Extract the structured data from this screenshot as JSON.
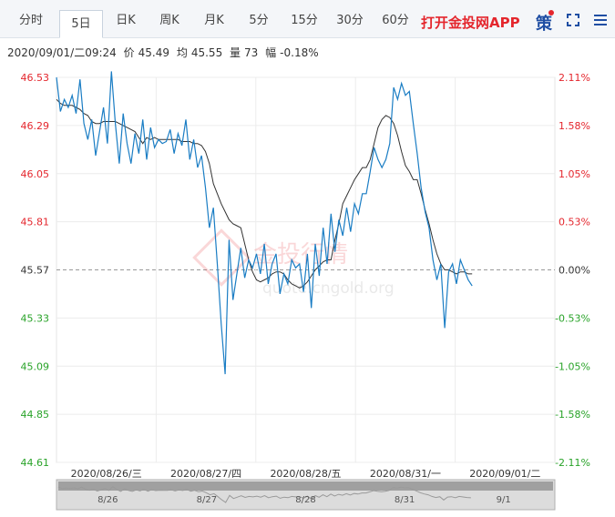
{
  "tabs": [
    {
      "label": "分时",
      "active": false
    },
    {
      "label": "5日",
      "active": true
    },
    {
      "label": "日K",
      "active": false
    },
    {
      "label": "周K",
      "active": false
    },
    {
      "label": "月K",
      "active": false
    },
    {
      "label": "5分",
      "active": false
    },
    {
      "label": "15分",
      "active": false
    },
    {
      "label": "30分",
      "active": false
    },
    {
      "label": "60分",
      "active": false
    }
  ],
  "promo_label": "打开金投网APP",
  "toolbar": {
    "ce_label": "策",
    "fullscreen_icon": "fullscreen-icon",
    "menu_icon": "menu-icon"
  },
  "info": {
    "datetime": "2020/09/01/二09:24",
    "price_label": "价",
    "price": "45.49",
    "avg_label": "均",
    "avg": "45.55",
    "volume_label": "量",
    "volume": "73",
    "change_label": "幅",
    "change": "-0.18%"
  },
  "watermark": {
    "text": "金投行情",
    "url": "quote.cngold.org"
  },
  "colors": {
    "up": "#e4262d",
    "down": "#29a329",
    "price_line": "#1a7dc4",
    "avg_line": "#333333",
    "axis_text": "#333333"
  },
  "chart_data": {
    "type": "line",
    "y_axis_left": [
      "46.53",
      "46.29",
      "46.05",
      "45.81",
      "45.57",
      "45.33",
      "45.09",
      "44.85",
      "44.61"
    ],
    "y_axis_right": [
      "2.11%",
      "1.58%",
      "1.05%",
      "0.53%",
      "0.00%",
      "-0.53%",
      "-1.05%",
      "-1.58%",
      "-2.11%"
    ],
    "ylim": [
      44.61,
      46.53
    ],
    "reference_price": 45.57,
    "days": [
      "2020/08/26/三",
      "2020/08/27/四",
      "2020/08/28/五",
      "2020/08/31/一",
      "2020/09/01/二"
    ],
    "navigator_labels": [
      "8/26",
      "8/27",
      "8/28",
      "8/31",
      "9/1"
    ],
    "series": [
      {
        "name": "价",
        "values": [
          46.53,
          46.36,
          46.42,
          46.38,
          46.44,
          46.35,
          46.52,
          46.3,
          46.22,
          46.32,
          46.14,
          46.26,
          46.38,
          46.2,
          46.56,
          46.3,
          46.1,
          46.35,
          46.2,
          46.1,
          46.25,
          46.15,
          46.32,
          46.12,
          46.28,
          46.18,
          46.22,
          46.2,
          46.21,
          46.27,
          46.15,
          46.25,
          46.19,
          46.32,
          46.12,
          46.22,
          46.08,
          46.14,
          45.98,
          45.78,
          45.88,
          45.6,
          45.3,
          45.05,
          45.72,
          45.42,
          45.55,
          45.68,
          45.53,
          45.62,
          45.58,
          45.65,
          45.55,
          45.7,
          45.5,
          45.6,
          45.65,
          45.45,
          45.55,
          45.5,
          45.62,
          45.58,
          45.6,
          45.46,
          45.65,
          45.38,
          45.7,
          45.54,
          45.78,
          45.6,
          45.85,
          45.66,
          45.82,
          45.74,
          45.88,
          45.76,
          45.9,
          45.85,
          45.95,
          45.95,
          46.06,
          46.18,
          46.12,
          46.08,
          46.12,
          46.2,
          46.48,
          46.42,
          46.5,
          46.44,
          46.46,
          46.3,
          46.15,
          45.98,
          45.86,
          45.78,
          45.62,
          45.52,
          45.6,
          45.28,
          45.56,
          45.6,
          45.5,
          45.62,
          45.57,
          45.52,
          45.49
        ]
      },
      {
        "name": "均",
        "values": [
          46.42,
          46.4,
          46.39,
          46.39,
          46.39,
          46.38,
          46.37,
          46.35,
          46.34,
          46.31,
          46.3,
          46.3,
          46.31,
          46.31,
          46.31,
          46.31,
          46.3,
          46.29,
          46.28,
          46.27,
          46.26,
          46.23,
          46.2,
          46.23,
          46.22,
          46.23,
          46.22,
          46.22,
          46.22,
          46.22,
          46.22,
          46.22,
          46.21,
          46.21,
          46.21,
          46.2,
          46.2,
          46.19,
          46.16,
          46.1,
          46.0,
          45.95,
          45.9,
          45.86,
          45.82,
          45.8,
          45.79,
          45.78,
          45.7,
          45.62,
          45.56,
          45.52,
          45.51,
          45.52,
          45.53,
          45.55,
          45.56,
          45.56,
          45.55,
          45.52,
          45.5,
          45.49,
          45.48,
          45.49,
          45.51,
          45.54,
          45.57,
          45.59,
          45.61,
          45.62,
          45.62,
          45.72,
          45.8,
          45.9,
          45.94,
          45.98,
          46.02,
          46.05,
          46.08,
          46.08,
          46.12,
          46.2,
          46.28,
          46.32,
          46.34,
          46.33,
          46.3,
          46.24,
          46.16,
          46.09,
          46.06,
          46.02,
          46.02,
          45.95,
          45.87,
          45.8,
          45.72,
          45.65,
          45.6,
          45.57,
          45.57,
          45.56,
          45.55,
          45.56,
          45.56,
          45.55,
          45.55
        ]
      }
    ],
    "grid": true,
    "legend": "none"
  }
}
